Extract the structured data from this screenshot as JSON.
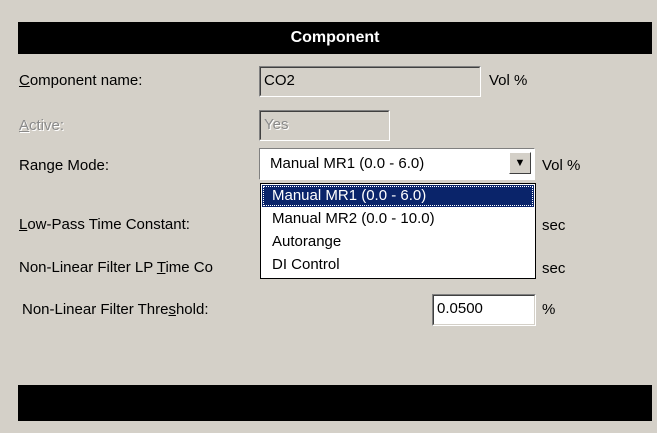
{
  "panel": {
    "title": "Component"
  },
  "fields": {
    "component_name": {
      "label_accel": "C",
      "label_rest": "omponent name:",
      "value": "CO2",
      "unit": "Vol %"
    },
    "active": {
      "label_accel": "A",
      "label_rest": "ctive:",
      "value": "Yes"
    },
    "range_mode": {
      "label": "Range Mode:",
      "value": "Manual MR1 (0.0 - 6.0)",
      "unit": "Vol %",
      "options": [
        "Manual MR1 (0.0 - 6.0)",
        "Manual MR2 (0.0 - 10.0)",
        "Autorange",
        "DI Control"
      ]
    },
    "low_pass": {
      "label_accel": "L",
      "label_rest": "ow-Pass Time Constant:",
      "unit": "sec"
    },
    "nonlinear_lp": {
      "label_pre": "Non-Linear Filter LP ",
      "label_accel": "T",
      "label_rest": "ime Co",
      "unit": "sec"
    },
    "nonlinear_threshold": {
      "label_pre": "Non-Linear Filter Thre",
      "label_accel": "s",
      "label_rest": "hold:",
      "value": "0.0500",
      "unit": "%"
    }
  }
}
